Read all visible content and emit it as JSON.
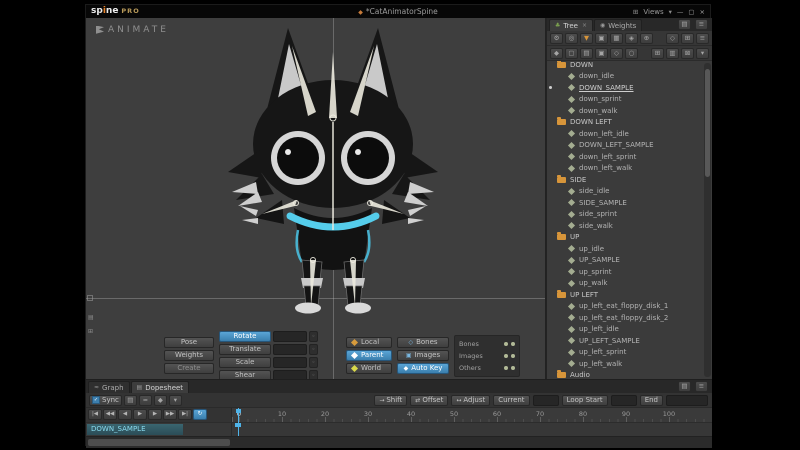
{
  "titlebar": {
    "logo_left": "sp",
    "logo_i": "i",
    "logo_right": "ne",
    "edition": "PRO",
    "app_icon_glyph": "◆",
    "document_title": "*CatAnimatorSpine",
    "views_grid_glyph": "⊞",
    "views_label": "Views",
    "views_caret": "▾",
    "minimize_glyph": "—",
    "maximize_glyph": "▢",
    "close_glyph": "×"
  },
  "viewport": {
    "mode_label": "ANIMATE"
  },
  "tree_panel": {
    "tabs": [
      {
        "label": "Tree",
        "icon": "♣",
        "close_glyph": "×",
        "active": true
      },
      {
        "label": "Weights",
        "icon": "◉",
        "active": false
      }
    ],
    "tab_icons_right": [
      {
        "name": "panel-layout-icon",
        "glyph": "▤"
      },
      {
        "name": "panel-menu-icon",
        "glyph": "≡"
      }
    ],
    "toolbar_row1_left": [
      {
        "name": "tree-settings-icon",
        "glyph": "⚙"
      },
      {
        "name": "tree-zoom-icon",
        "glyph": "◎"
      },
      {
        "name": "tree-filter-icon",
        "glyph": "▼",
        "color": "#d7953a"
      },
      {
        "name": "tree-ghost-icon",
        "glyph": "▣"
      },
      {
        "name": "tree-grid-icon",
        "glyph": "▦"
      },
      {
        "name": "tree-pose-icon",
        "glyph": "◈"
      },
      {
        "name": "tree-compensate-icon",
        "glyph": "⊕"
      }
    ],
    "toolbar_row1_right": [
      {
        "name": "tree-pin-icon",
        "glyph": "◇"
      },
      {
        "name": "tree-expand-all-icon",
        "glyph": "⊞"
      },
      {
        "name": "tree-menu-icon",
        "glyph": "≡"
      }
    ],
    "toolbar_row2_left": [
      {
        "name": "filter-bones-icon",
        "glyph": "◆"
      },
      {
        "name": "filter-slots-icon",
        "glyph": "▢"
      },
      {
        "name": "filter-skins-icon",
        "glyph": "▤"
      },
      {
        "name": "filter-images-icon",
        "glyph": "▣"
      },
      {
        "name": "filter-events-icon",
        "glyph": "◇"
      },
      {
        "name": "filter-audio-icon",
        "glyph": "○"
      }
    ],
    "toolbar_row2_right": [
      {
        "name": "new-setup-icon",
        "glyph": "⊞"
      },
      {
        "name": "duplicate-icon",
        "glyph": "▥"
      },
      {
        "name": "delete-icon",
        "glyph": "⊠"
      },
      {
        "name": "tree-more-icon",
        "glyph": "▾"
      }
    ],
    "items": [
      {
        "label": "DOWN",
        "type": "folder"
      },
      {
        "label": "down_idle",
        "type": "anim"
      },
      {
        "label": "DOWN_SAMPLE",
        "type": "anim",
        "active": true,
        "marker": true
      },
      {
        "label": "down_sprint",
        "type": "anim"
      },
      {
        "label": "down_walk",
        "type": "anim"
      },
      {
        "label": "DOWN LEFT",
        "type": "folder"
      },
      {
        "label": "down_left_idle",
        "type": "anim"
      },
      {
        "label": "DOWN_LEFT_SAMPLE",
        "type": "anim"
      },
      {
        "label": "down_left_sprint",
        "type": "anim"
      },
      {
        "label": "down_left_walk",
        "type": "anim"
      },
      {
        "label": "SIDE",
        "type": "folder"
      },
      {
        "label": "side_idle",
        "type": "anim"
      },
      {
        "label": "SIDE_SAMPLE",
        "type": "anim"
      },
      {
        "label": "side_sprint",
        "type": "anim"
      },
      {
        "label": "side_walk",
        "type": "anim"
      },
      {
        "label": "UP",
        "type": "folder"
      },
      {
        "label": "up_idle",
        "type": "anim"
      },
      {
        "label": "UP_SAMPLE",
        "type": "anim"
      },
      {
        "label": "up_sprint",
        "type": "anim"
      },
      {
        "label": "up_walk",
        "type": "anim"
      },
      {
        "label": "UP LEFT",
        "type": "folder"
      },
      {
        "label": "up_left_eat_floppy_disk_1",
        "type": "anim"
      },
      {
        "label": "up_left_eat_floppy_disk_2",
        "type": "anim"
      },
      {
        "label": "up_left_idle",
        "type": "anim"
      },
      {
        "label": "UP_LEFT_SAMPLE",
        "type": "anim"
      },
      {
        "label": "up_left_sprint",
        "type": "anim"
      },
      {
        "label": "up_left_walk",
        "type": "anim"
      },
      {
        "label": "Audio",
        "type": "folder"
      }
    ]
  },
  "tools": {
    "mode_buttons": [
      {
        "label": "Pose"
      },
      {
        "label": "Weights"
      },
      {
        "label": "Create",
        "dim": true
      }
    ],
    "transform_rows": [
      {
        "label": "Rotate",
        "value": "",
        "selected": true
      },
      {
        "label": "Translate",
        "value": "",
        "selected": false
      },
      {
        "label": "Scale",
        "value": "",
        "selected": false
      },
      {
        "label": "Shear",
        "value": "",
        "selected": false
      }
    ],
    "axes_buttons": [
      {
        "label": "Local",
        "selected": false,
        "icon_color": "#d79b3c"
      },
      {
        "label": "Parent",
        "selected": true,
        "icon_color": "#ffffff"
      },
      {
        "label": "World",
        "selected": false,
        "icon_color": "#d9d94a"
      }
    ],
    "toggle_buttons": [
      {
        "label": "Bones",
        "icon": "◇",
        "selected": false
      },
      {
        "label": "Images",
        "icon": "▣",
        "selected": false
      },
      {
        "label": "Auto Key",
        "icon": "◆",
        "selected": true
      }
    ],
    "visibility_rows": [
      {
        "label": "Bones"
      },
      {
        "label": "Images"
      },
      {
        "label": "Others"
      }
    ]
  },
  "dopesheet": {
    "tabs": [
      {
        "label": "Graph",
        "icon": "≈",
        "active": false
      },
      {
        "label": "Dopesheet",
        "icon": "▤",
        "active": true
      }
    ],
    "tab_icons_right": [
      {
        "name": "dopesheet-layout-icon",
        "glyph": "▤"
      },
      {
        "name": "dopesheet-menu-icon",
        "glyph": "≡"
      }
    ],
    "sync_label": "Sync",
    "sync_check_glyph": "✓",
    "left_icons": [
      {
        "name": "dopesheet-options-icon",
        "glyph": "▤"
      },
      {
        "name": "curve-filter-icon",
        "glyph": "≈"
      },
      {
        "name": "key-filter-icon",
        "glyph": "◆"
      },
      {
        "name": "collapse-icon",
        "glyph": "▾"
      }
    ],
    "playback": [
      {
        "name": "first-frame-button",
        "glyph": "|◀"
      },
      {
        "name": "prev-keyframe-button",
        "glyph": "◀◀"
      },
      {
        "name": "prev-frame-button",
        "glyph": "◀"
      },
      {
        "name": "play-button",
        "glyph": "▶"
      },
      {
        "name": "next-frame-button",
        "glyph": "▶"
      },
      {
        "name": "next-keyframe-button",
        "glyph": "▶▶"
      },
      {
        "name": "last-frame-button",
        "glyph": "▶|"
      },
      {
        "name": "loop-button",
        "glyph": "↻",
        "selected": true
      }
    ],
    "edit_buttons": [
      {
        "label": "Shift",
        "icon": "→"
      },
      {
        "label": "Offset",
        "icon": "⇄"
      },
      {
        "label": "Adjust",
        "icon": "↔"
      }
    ],
    "range_fields": [
      {
        "label": "Current",
        "value": ""
      },
      {
        "label": "Loop Start",
        "value": ""
      },
      {
        "label": "End",
        "value": ""
      }
    ],
    "ruler": [
      "0",
      "10",
      "20",
      "30",
      "40",
      "50",
      "60",
      "70",
      "80",
      "90",
      "100"
    ],
    "playhead_frame": "0",
    "track_label": "DOWN_SAMPLE"
  },
  "colors": {
    "accent_blue": "#4a94c9",
    "folder_orange": "#d7953a",
    "collar_cyan": "#55cdeb",
    "track_teal": "#8adcf0"
  }
}
